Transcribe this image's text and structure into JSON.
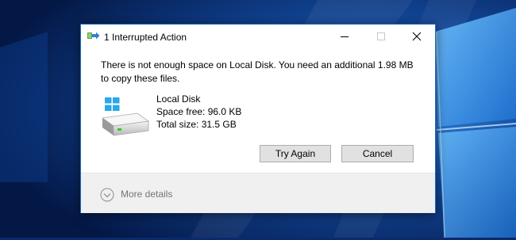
{
  "dialog": {
    "title": "1 Interrupted Action",
    "message": "There is not enough space on Local Disk. You need an additional 1.98 MB to copy these files.",
    "drive": {
      "name": "Local Disk",
      "space_free": "Space free: 96.0 KB",
      "total_size": "Total size: 31.5 GB"
    },
    "buttons": {
      "retry": "Try Again",
      "cancel": "Cancel"
    },
    "more_details": "More details"
  },
  "icons": {
    "app": "file-copy-arrow-icon",
    "drive": "local-disk-windows-drive-icon",
    "expand": "chevron-down-circle-icon"
  },
  "colors": {
    "desktop_bg": "#0a2a6e",
    "window_border": "#1f6fbf",
    "button_bg": "#e1e1e1",
    "footer_bg": "#f0f0f0",
    "windows_logo": "#29a8ea"
  }
}
